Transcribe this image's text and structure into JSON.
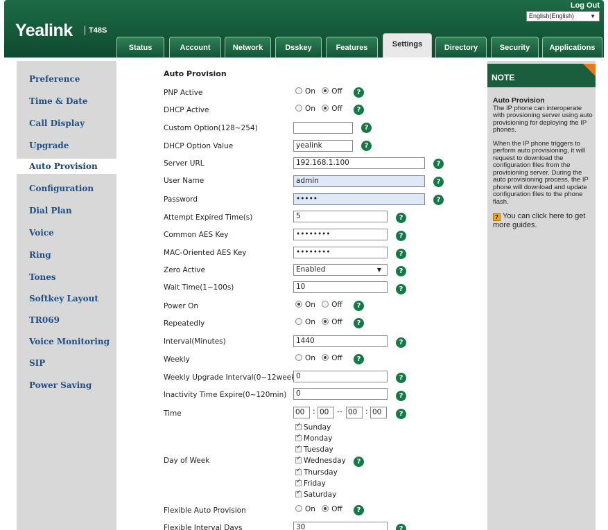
{
  "header": {
    "brand": "Yealink",
    "model": "T48S",
    "logout": "Log Out",
    "language": "English(English)",
    "tabs": [
      "Status",
      "Account",
      "Network",
      "Dsskey",
      "Features",
      "Settings",
      "Directory",
      "Security",
      "Applications"
    ],
    "active_tab": "Settings"
  },
  "sidebar": {
    "items": [
      "Preference",
      "Time & Date",
      "Call Display",
      "Upgrade",
      "Auto Provision",
      "Configuration",
      "Dial Plan",
      "Voice",
      "Ring",
      "Tones",
      "Softkey Layout",
      "TR069",
      "Voice Monitoring",
      "SIP",
      "Power Saving"
    ],
    "active": "Auto Provision"
  },
  "form": {
    "section_title": "Auto Provision",
    "radio_on": "On",
    "radio_off": "Off",
    "help": "?",
    "pnp_active": {
      "label": "PNP Active",
      "value": "Off"
    },
    "dhcp_active": {
      "label": "DHCP Active",
      "value": "Off"
    },
    "custom_option": {
      "label": "Custom Option(128~254)",
      "value": ""
    },
    "dhcp_option_value": {
      "label": "DHCP Option Value",
      "value": "yealink"
    },
    "server_url": {
      "label": "Server URL",
      "value": "192.168.1.100"
    },
    "user_name": {
      "label": "User Name",
      "value": "admin"
    },
    "password": {
      "label": "Password",
      "value": "•••••"
    },
    "attempt_expired": {
      "label": "Attempt Expired Time(s)",
      "value": "5"
    },
    "common_aes": {
      "label": "Common AES Key",
      "value": "••••••••"
    },
    "mac_aes": {
      "label": "MAC-Oriented AES Key",
      "value": "••••••••"
    },
    "zero_active": {
      "label": "Zero Active",
      "value": "Enabled"
    },
    "wait_time": {
      "label": "Wait Time(1~100s)",
      "value": "10"
    },
    "power_on": {
      "label": "Power On",
      "value": "On"
    },
    "repeatedly": {
      "label": "Repeatedly",
      "value": "Off"
    },
    "interval": {
      "label": "Interval(Minutes)",
      "value": "1440"
    },
    "weekly": {
      "label": "Weekly",
      "value": "Off"
    },
    "weekly_upgrade_interval": {
      "label": "Weekly Upgrade Interval(0~12week)",
      "value": "0"
    },
    "inactivity_time": {
      "label": "Inactivity Time Expire(0~120min)",
      "value": "0"
    },
    "time": {
      "label": "Time",
      "h1": "00",
      "m1": "00",
      "h2": "00",
      "m2": "00",
      "sep_colon": ":",
      "sep_dash": "--"
    },
    "day_of_week": {
      "label": "Day of Week",
      "days": [
        "Sunday",
        "Monday",
        "Tuesday",
        "Wednesday",
        "Thursday",
        "Friday",
        "Saturday"
      ]
    },
    "flexible_auto_provision": {
      "label": "Flexible Auto Provision",
      "value": "Off"
    },
    "flexible_interval_days": {
      "label": "Flexible Interval Days",
      "value": "30"
    }
  },
  "note": {
    "title": "NOTE",
    "heading": "Auto Provision",
    "para1": "The IP phone can interoperate with provsioning server using auto provisioning for deploying the IP phones.",
    "para2": "When the IP phone triggers to perform auto provisioning, it will request to download the configuration files from the provisioning server. During the auto provisioning process, the IP phone will download and update configuration files to the phone flash.",
    "guide": "You can click here to get more guides.",
    "guide_icon": "?"
  }
}
